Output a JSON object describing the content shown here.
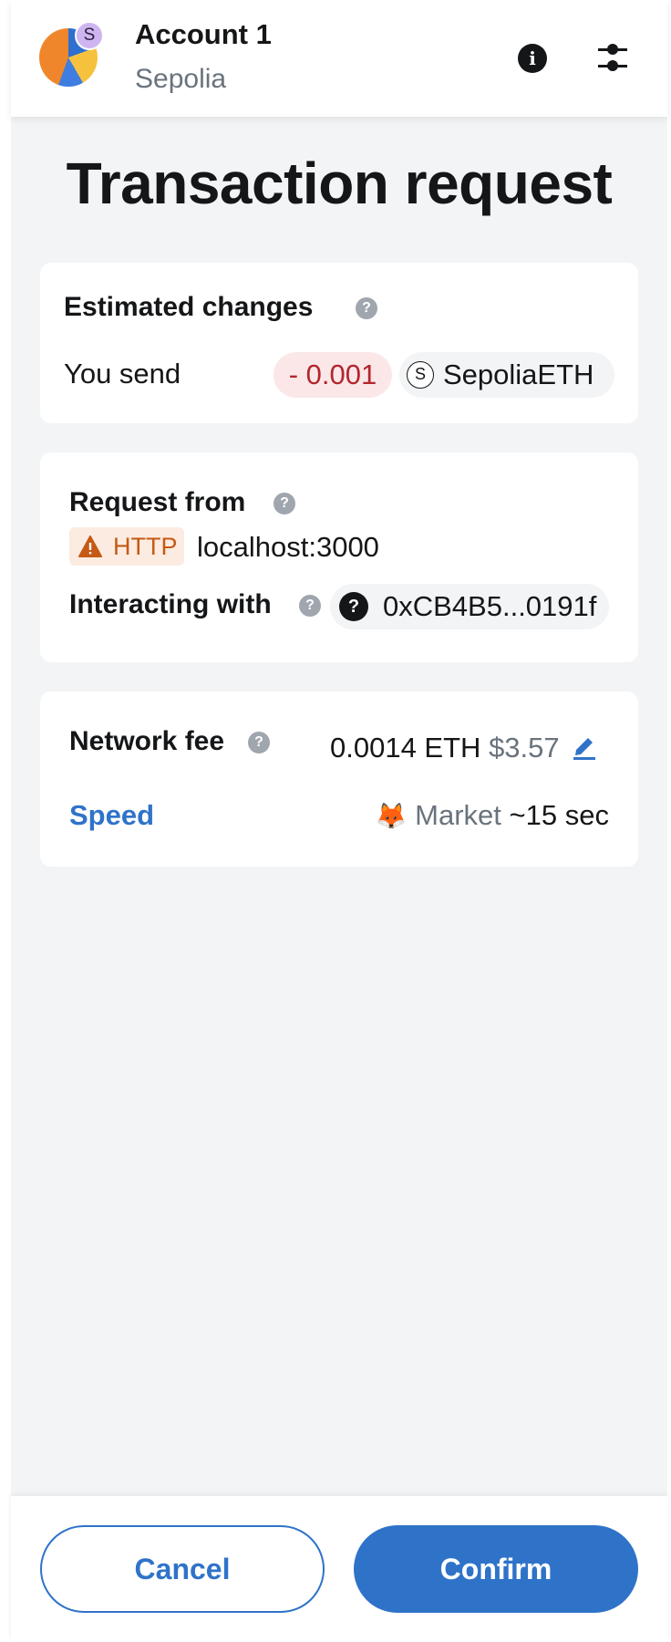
{
  "header": {
    "network_badge_letter": "S",
    "account_name": "Account 1",
    "network_name": "Sepolia",
    "info_icon": "info-icon",
    "settings_icon": "sliders-icon"
  },
  "title": "Transaction request",
  "estimated_changes": {
    "heading": "Estimated changes",
    "row_label": "You send",
    "amount": "- 0.001",
    "token_icon_letter": "S",
    "token_name": "SepoliaETH"
  },
  "request": {
    "heading": "Request from",
    "protocol_label": "HTTP",
    "origin": "localhost:3000",
    "interacting_label": "Interacting with",
    "contract_icon_glyph": "?",
    "contract_address": "0xCB4B5...0191f"
  },
  "fees": {
    "network_fee_label": "Network fee",
    "fee_native": "0.0014 ETH",
    "fee_fiat": "$3.57",
    "speed_label": "Speed",
    "speed_emoji": "🦊",
    "speed_value": "Market",
    "speed_time": "~15 sec"
  },
  "footer": {
    "cancel_label": "Cancel",
    "confirm_label": "Confirm"
  },
  "colors": {
    "primary": "#2f73c9",
    "error_bg": "#fbe7e8",
    "error_text": "#b3262f",
    "warning_bg": "#fcebe0",
    "warning_text": "#c45a16",
    "muted": "#6a737d",
    "background": "#f2f4f6"
  }
}
